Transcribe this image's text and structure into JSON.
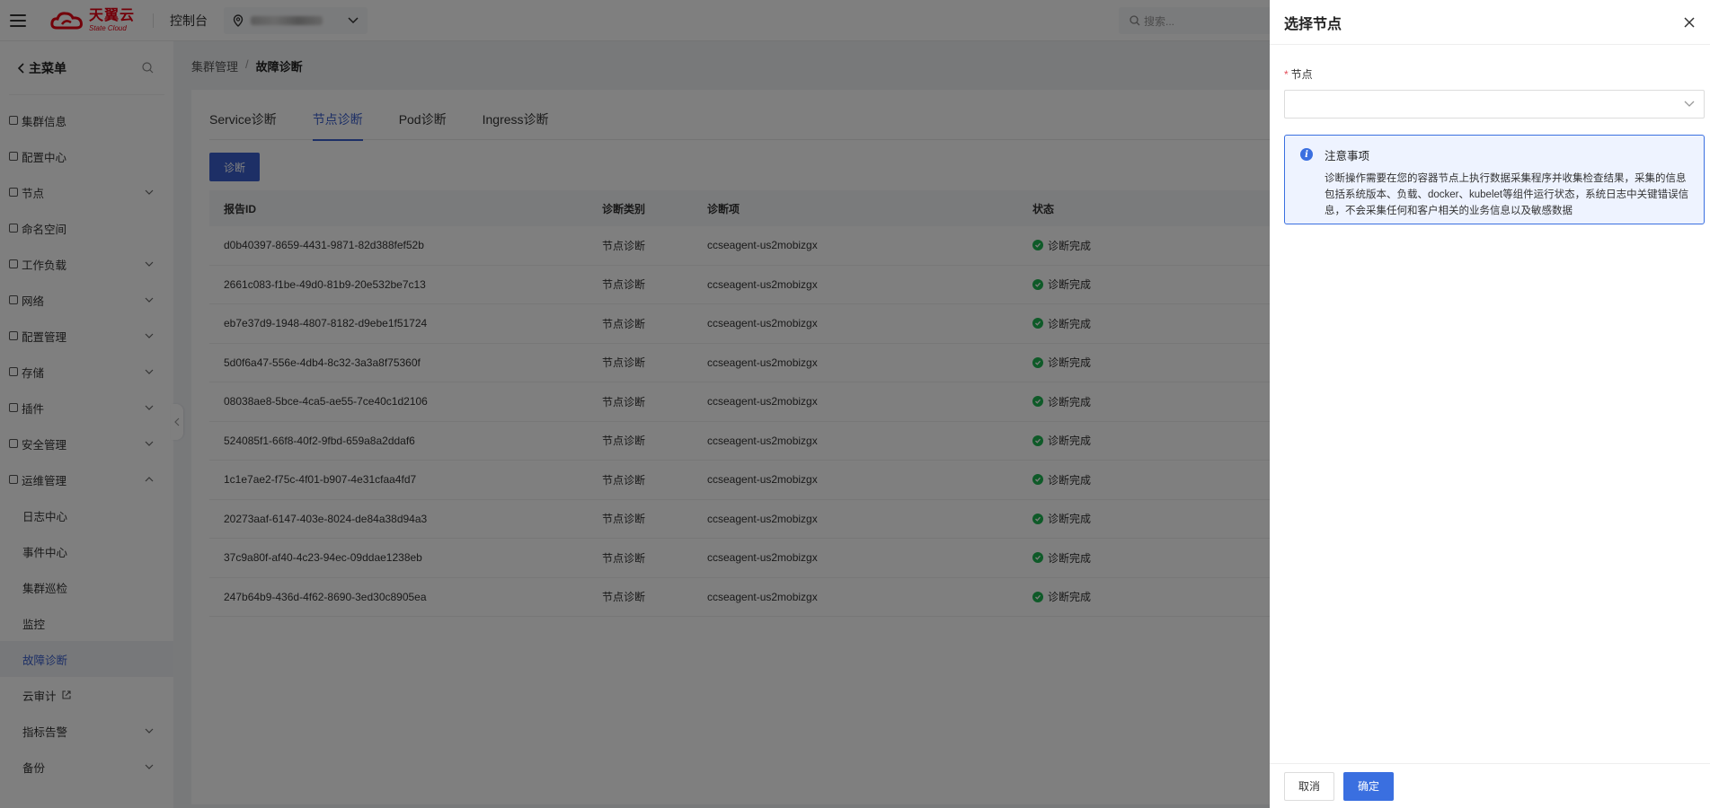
{
  "header": {
    "console_label": "控制台",
    "search_placeholder": "搜索...",
    "logo_cn": "天翼云",
    "logo_en": "State Cloud"
  },
  "sidebar": {
    "back_label": "主菜单",
    "items": [
      {
        "label": "集群信息",
        "icon": "cluster-icon",
        "chevron": false
      },
      {
        "label": "配置中心",
        "icon": "config-icon",
        "chevron": false
      },
      {
        "label": "节点",
        "icon": "node-icon",
        "chevron": true
      },
      {
        "label": "命名空间",
        "icon": "namespace-icon",
        "chevron": false
      },
      {
        "label": "工作负载",
        "icon": "workload-icon",
        "chevron": true
      },
      {
        "label": "网络",
        "icon": "network-icon",
        "chevron": true
      },
      {
        "label": "配置管理",
        "icon": "config-manage-icon",
        "chevron": true
      },
      {
        "label": "存储",
        "icon": "storage-icon",
        "chevron": true
      },
      {
        "label": "插件",
        "icon": "plugin-icon",
        "chevron": true
      },
      {
        "label": "安全管理",
        "icon": "security-icon",
        "chevron": true
      },
      {
        "label": "运维管理",
        "icon": "ops-icon",
        "chevron": "up"
      }
    ],
    "sub_items": [
      {
        "label": "日志中心"
      },
      {
        "label": "事件中心"
      },
      {
        "label": "集群巡检"
      },
      {
        "label": "监控"
      },
      {
        "label": "故障诊断",
        "active": true
      },
      {
        "label": "云审计",
        "external": true
      },
      {
        "label": "指标告警",
        "chevron": true
      },
      {
        "label": "备份",
        "chevron": true
      }
    ]
  },
  "breadcrumb": {
    "parent": "集群管理",
    "separator": "/",
    "current": "故障诊断"
  },
  "tabs": [
    "Service诊断",
    "节点诊断",
    "Pod诊断",
    "Ingress诊断"
  ],
  "active_tab": 1,
  "diagnose_button": "诊断",
  "table": {
    "headers": [
      "报告ID",
      "诊断类别",
      "诊断项",
      "状态"
    ],
    "rows": [
      [
        "d0b40397-8659-4431-9871-82d388fef52b",
        "节点诊断",
        "ccseagent-us2mobizgx",
        "诊断完成"
      ],
      [
        "2661c083-f1be-49d0-81b9-20e532be7c13",
        "节点诊断",
        "ccseagent-us2mobizgx",
        "诊断完成"
      ],
      [
        "eb7e37d9-1948-4807-8182-d9ebe1f51724",
        "节点诊断",
        "ccseagent-us2mobizgx",
        "诊断完成"
      ],
      [
        "5d0f6a47-556e-4db4-8c32-3a3a8f75360f",
        "节点诊断",
        "ccseagent-us2mobizgx",
        "诊断完成"
      ],
      [
        "08038ae8-5bce-4ca5-ae55-7ce40c1d2106",
        "节点诊断",
        "ccseagent-us2mobizgx",
        "诊断完成"
      ],
      [
        "524085f1-66f8-40f2-9fbd-659a8a2ddaf6",
        "节点诊断",
        "ccseagent-us2mobizgx",
        "诊断完成"
      ],
      [
        "1c1e7ae2-f75c-4f01-b907-4e31cfaa4fd7",
        "节点诊断",
        "ccseagent-us2mobizgx",
        "诊断完成"
      ],
      [
        "20273aaf-6147-403e-8024-de84a38d94a3",
        "节点诊断",
        "ccseagent-us2mobizgx",
        "诊断完成"
      ],
      [
        "37c9a80f-af40-4c23-94ec-09ddae1238eb",
        "节点诊断",
        "ccseagent-us2mobizgx",
        "诊断完成"
      ],
      [
        "247b64b9-436d-4f62-8690-3ed30c8905ea",
        "节点诊断",
        "ccseagent-us2mobizgx",
        "诊断完成"
      ]
    ]
  },
  "drawer": {
    "title": "选择节点",
    "field_label": "节点",
    "required_mark": "*",
    "select_value": "",
    "notice_title": "注意事项",
    "notice_body": "诊断操作需要在您的容器节点上执行数据采集程序并收集检查结果，采集的信息包括系统版本、负载、docker、kubelet等组件运行状态，系统日志中关键错误信息，不会采集任何和客户相关的业务信息以及敏感数据",
    "cancel_label": "取消",
    "confirm_label": "确定"
  },
  "colors": {
    "primary": "#3a5fcd",
    "success": "#1db451",
    "brand_red": "#e60012",
    "notice_border": "#3a6fe0"
  }
}
